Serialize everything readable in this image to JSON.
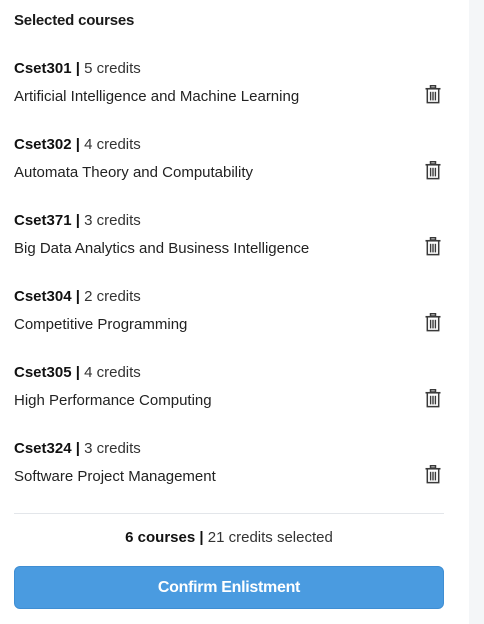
{
  "panel": {
    "title": "Selected courses"
  },
  "courses": [
    {
      "code": "Cset301",
      "separator": "|",
      "credits": "5 credits",
      "name": "Artificial Intelligence and Machine Learning"
    },
    {
      "code": "Cset302",
      "separator": "|",
      "credits": "4 credits",
      "name": "Automata Theory and Computability"
    },
    {
      "code": "Cset371",
      "separator": "|",
      "credits": "3 credits",
      "name": "Big Data Analytics and Business Intelligence"
    },
    {
      "code": "Cset304",
      "separator": "|",
      "credits": "2 credits",
      "name": "Competitive Programming"
    },
    {
      "code": "Cset305",
      "separator": "|",
      "credits": "4 credits",
      "name": "High Performance Computing"
    },
    {
      "code": "Cset324",
      "separator": "|",
      "credits": "3 credits",
      "name": "Software Project Management"
    }
  ],
  "icons": {
    "delete": "trash-icon"
  },
  "summary": {
    "courses": "6 courses",
    "separator": "|",
    "credits": "21 credits selected"
  },
  "actions": {
    "confirm_label": "Confirm Enlistment"
  },
  "colors": {
    "accent": "#4a9be0",
    "icon": "#3a3a3a"
  }
}
